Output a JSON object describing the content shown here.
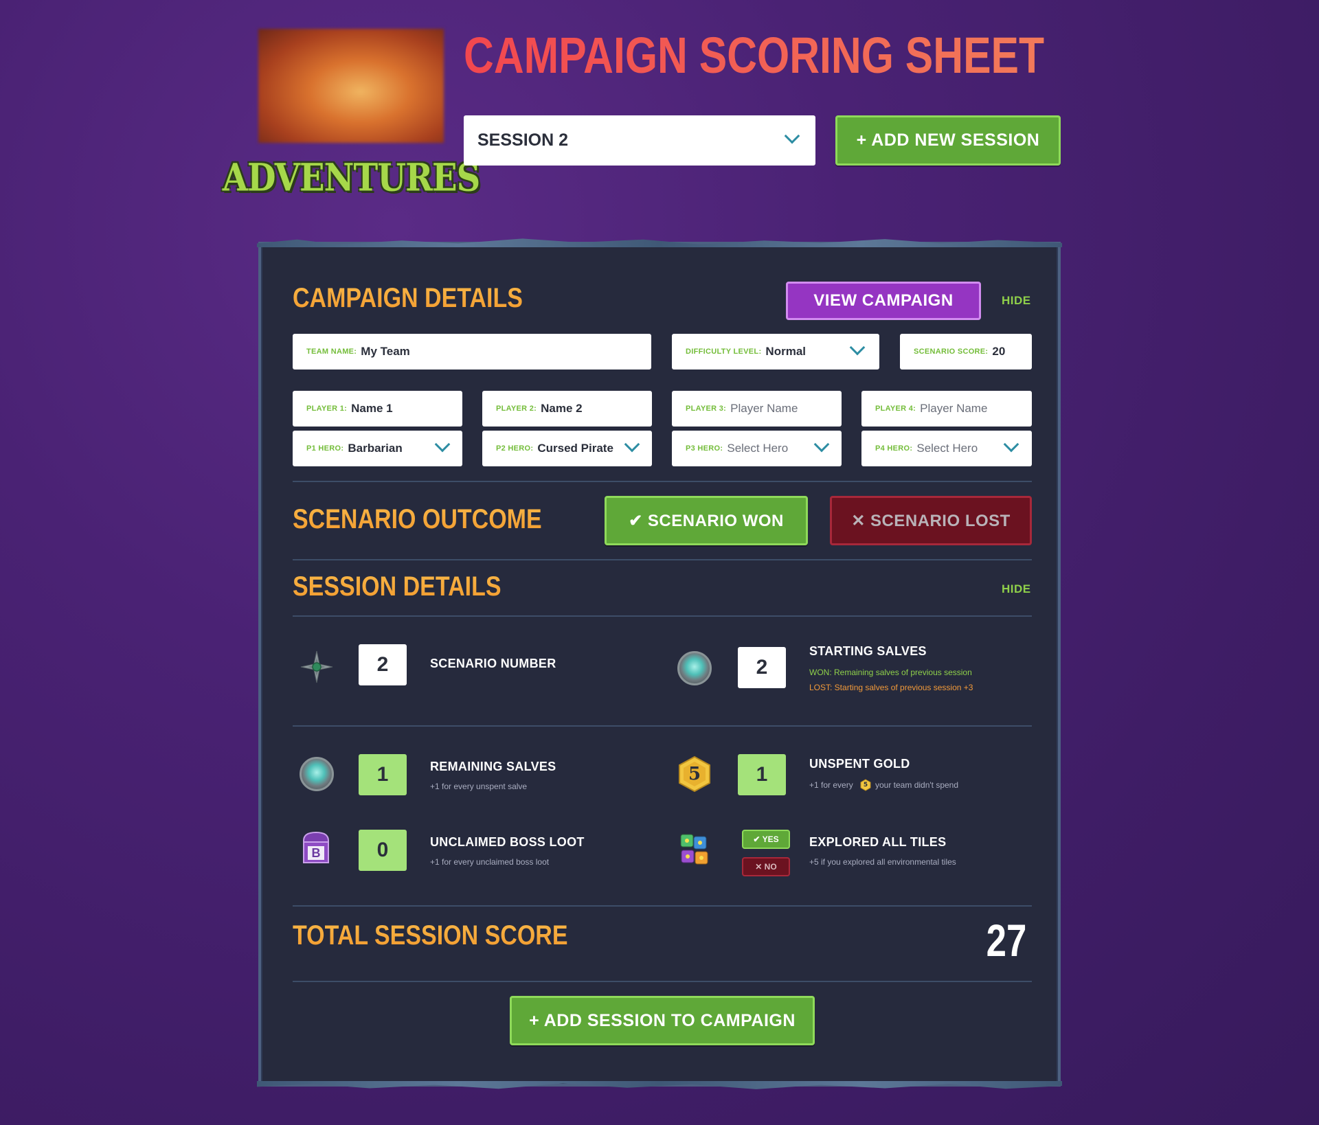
{
  "header": {
    "title": "CAMPAIGN SCORING SHEET",
    "logo_text": "ADVENTURES",
    "session_select": "SESSION 2",
    "add_session_label": "+ ADD NEW SESSION"
  },
  "campaign": {
    "heading": "CAMPAIGN DETAILS",
    "view_label": "VIEW CAMPAIGN",
    "hide_label": "HIDE",
    "team": {
      "label": "TEAM NAME:",
      "value": "My Team"
    },
    "difficulty": {
      "label": "DIFFICULTY LEVEL:",
      "value": "Normal"
    },
    "scenario_score": {
      "label": "SCENARIO SCORE:",
      "value": "20"
    },
    "players": [
      {
        "label": "PLAYER 1:",
        "value": "Name 1",
        "hero_label": "P1 HERO:",
        "hero": "Barbarian"
      },
      {
        "label": "PLAYER 2:",
        "value": "Name 2",
        "hero_label": "P2 HERO:",
        "hero": "Cursed Pirate"
      },
      {
        "label": "PLAYER 3:",
        "placeholder": "Player Name",
        "hero_label": "P3 HERO:",
        "hero_placeholder": "Select Hero"
      },
      {
        "label": "PLAYER 4:",
        "placeholder": "Player Name",
        "hero_label": "P4 HERO:",
        "hero_placeholder": "Select Hero"
      }
    ]
  },
  "outcome": {
    "heading": "SCENARIO OUTCOME",
    "won_label": "✔ SCENARIO WON",
    "lost_label": "✕ SCENARIO LOST"
  },
  "session": {
    "heading": "SESSION DETAILS",
    "hide_label": "HIDE",
    "scenario_number": {
      "title": "SCENARIO NUMBER",
      "value": "2",
      "icon": "compass-star-icon"
    },
    "starting_salves": {
      "title": "STARTING SALVES",
      "value": "2",
      "icon": "salve-orb-icon",
      "won_note": "WON: Remaining salves of previous session",
      "lost_note": "LOST: Starting salves of previous session +3"
    },
    "remaining_salves": {
      "title": "REMAINING SALVES",
      "value": "1",
      "note": "+1 for every unspent salve",
      "icon": "salve-orb-icon"
    },
    "unspent_gold": {
      "title": "UNSPENT GOLD",
      "value": "1",
      "note_a": "+1 for every",
      "note_b": "your team didn't spend",
      "coin": "5",
      "icon": "gold-coin-icon"
    },
    "boss_loot": {
      "title": "UNCLAIMED BOSS LOOT",
      "value": "0",
      "note": "+1 for every unclaimed boss loot",
      "icon_letter": "B",
      "icon": "boss-loot-chest-icon"
    },
    "explored": {
      "title": "EXPLORED ALL TILES",
      "note": "+5 if you explored all environmental tiles",
      "yes_label": "✔ YES",
      "no_label": "✕ NO",
      "icon": "tiles-dice-icon"
    }
  },
  "total": {
    "heading": "TOTAL SESSION SCORE",
    "value": "27",
    "add_label": "+ ADD SESSION TO CAMPAIGN"
  },
  "colors": {
    "background": "#4a2274",
    "panel": "#262a3d",
    "accent_orange": "#f7a83a",
    "accent_green": "#5fa838",
    "accent_purple": "#9535c2",
    "title_red": "#f2575a"
  }
}
